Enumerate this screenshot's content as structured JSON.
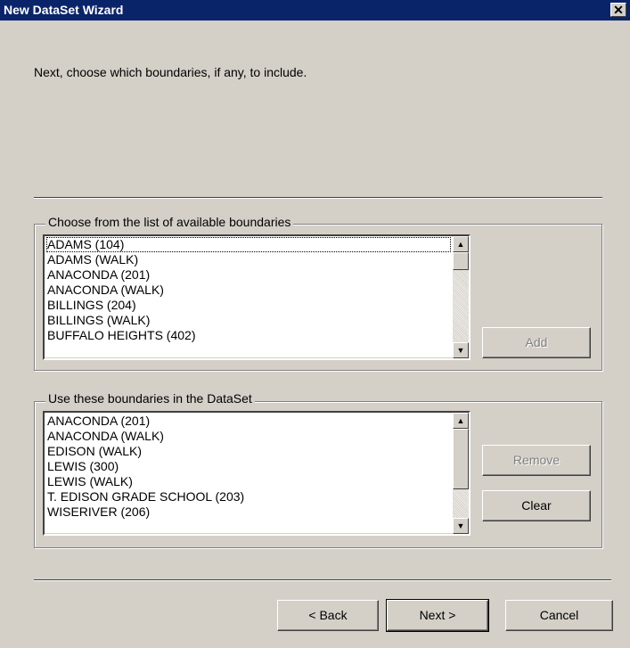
{
  "window": {
    "title": "New DataSet Wizard",
    "close_glyph": "✕"
  },
  "instruction": "Next, choose which boundaries, if any, to include.",
  "available": {
    "label": "Choose from the list of available boundaries",
    "items": [
      "ADAMS (104)",
      "ADAMS (WALK)",
      "ANACONDA (201)",
      "ANACONDA (WALK)",
      "BILLINGS (204)",
      "BILLINGS (WALK)",
      "BUFFALO HEIGHTS (402)"
    ],
    "add_label": "Add"
  },
  "selected": {
    "label": "Use these boundaries in the DataSet",
    "items": [
      "ANACONDA (201)",
      "ANACONDA (WALK)",
      "EDISON (WALK)",
      "LEWIS (300)",
      "LEWIS (WALK)",
      "T. EDISON GRADE SCHOOL (203)",
      "WISERIVER (206)"
    ],
    "remove_label": "Remove",
    "clear_label": "Clear"
  },
  "footer": {
    "back_label": "< Back",
    "next_label": "Next >",
    "cancel_label": "Cancel"
  },
  "icons": {
    "scroll_up": "up-arrow-icon",
    "scroll_down": "down-arrow-icon"
  }
}
